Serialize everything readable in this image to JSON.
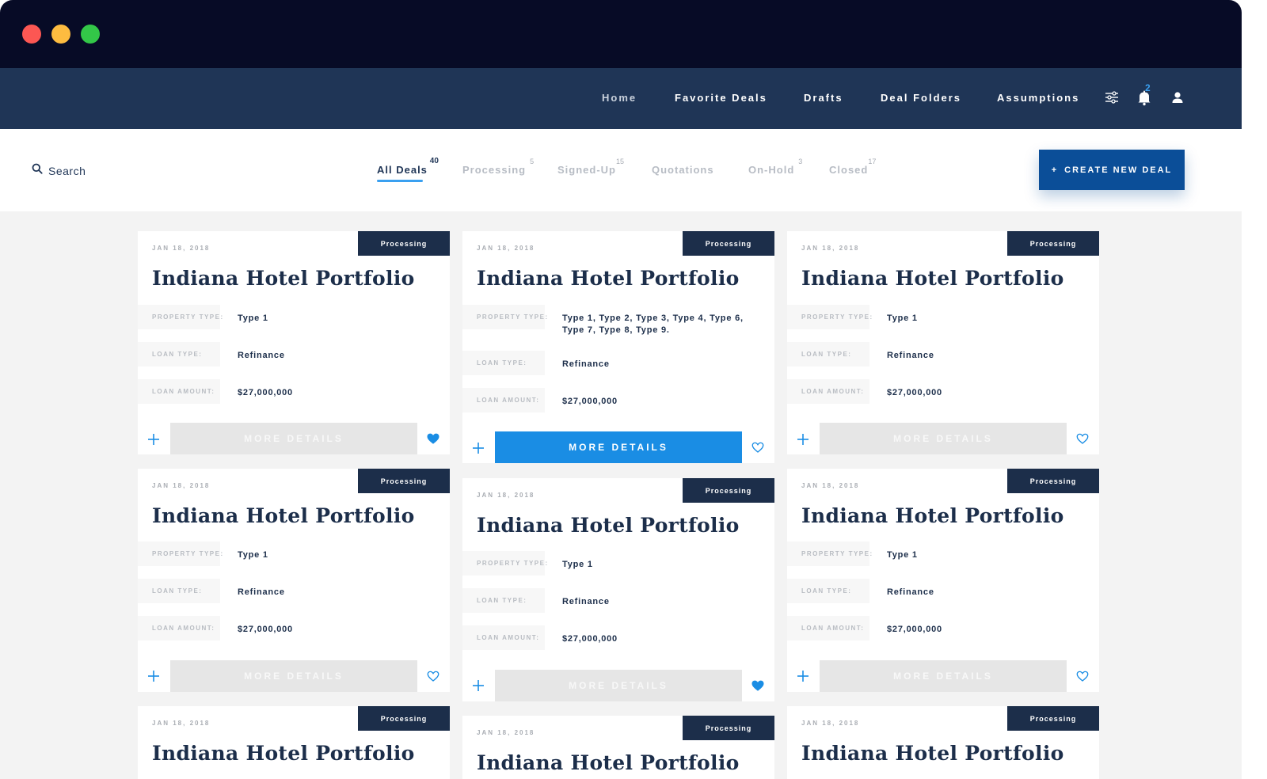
{
  "nav": {
    "links": [
      "Home",
      "Favorite Deals",
      "Drafts",
      "Deal Folders",
      "Assumptions"
    ],
    "notification_count": "2",
    "icons": [
      "sliders-icon",
      "bell-icon",
      "user-icon"
    ]
  },
  "toolbar": {
    "search_label": "Search",
    "tabs": [
      {
        "label": "All Deals",
        "count": "40"
      },
      {
        "label": "Processing",
        "count": "5"
      },
      {
        "label": "Signed-Up",
        "count": "15"
      },
      {
        "label": "Quotations",
        "count": ""
      },
      {
        "label": "On-Hold",
        "count": "3"
      },
      {
        "label": "Closed",
        "count": "17"
      }
    ],
    "create_plus": "+",
    "create_label": "CREATE NEW DEAL"
  },
  "labels": {
    "property_type": "PROPERTY TYPE:",
    "loan_type": "LOAN TYPE:",
    "loan_amount": "LOAN AMOUNT:",
    "more_details": "MORE DETAILS"
  },
  "colors": {
    "titlebar": "#070b26",
    "navbar": "#1f3556",
    "accent": "#1a8de4",
    "primary_button": "#0b4e98",
    "badge": "#1c2e4a"
  },
  "cards": [
    {
      "date": "JAN 18, 2018",
      "status": "Processing",
      "title": "Indiana Hotel Portfolio",
      "property_type": "Type 1",
      "loan_type": "Refinance",
      "loan_amount": "$27,000,000",
      "favorited": true,
      "details_active": false
    },
    {
      "date": "JAN 18, 2018",
      "status": "Processing",
      "title": "Indiana Hotel Portfolio",
      "property_type": "Type 1, Type 2, Type 3, Type 4, Type 6, Type 7, Type 8, Type 9.",
      "loan_type": "Refinance",
      "loan_amount": "$27,000,000",
      "favorited": false,
      "details_active": true
    },
    {
      "date": "JAN 18, 2018",
      "status": "Processing",
      "title": "Indiana Hotel Portfolio",
      "property_type": "Type 1",
      "loan_type": "Refinance",
      "loan_amount": "$27,000,000",
      "favorited": false,
      "details_active": false
    },
    {
      "date": "JAN 18, 2018",
      "status": "Processing",
      "title": "Indiana Hotel Portfolio",
      "property_type": "Type 1",
      "loan_type": "Refinance",
      "loan_amount": "$27,000,000",
      "favorited": false,
      "details_active": false
    },
    {
      "date": "JAN 18, 2018",
      "status": "Processing",
      "title": "Indiana Hotel Portfolio",
      "property_type": "Type 1",
      "loan_type": "Refinance",
      "loan_amount": "$27,000,000",
      "favorited": true,
      "details_active": false
    },
    {
      "date": "JAN 18, 2018",
      "status": "Processing",
      "title": "Indiana Hotel Portfolio",
      "property_type": "Type 1",
      "loan_type": "Refinance",
      "loan_amount": "$27,000,000",
      "favorited": false,
      "details_active": false
    },
    {
      "date": "JAN 18, 2018",
      "status": "Processing",
      "title": "Indiana Hotel Portfolio"
    },
    {
      "date": "JAN 18, 2018",
      "status": "Processing",
      "title": "Indiana Hotel Portfolio"
    },
    {
      "date": "JAN 18, 2018",
      "status": "Processing",
      "title": "Indiana Hotel Portfolio"
    }
  ]
}
